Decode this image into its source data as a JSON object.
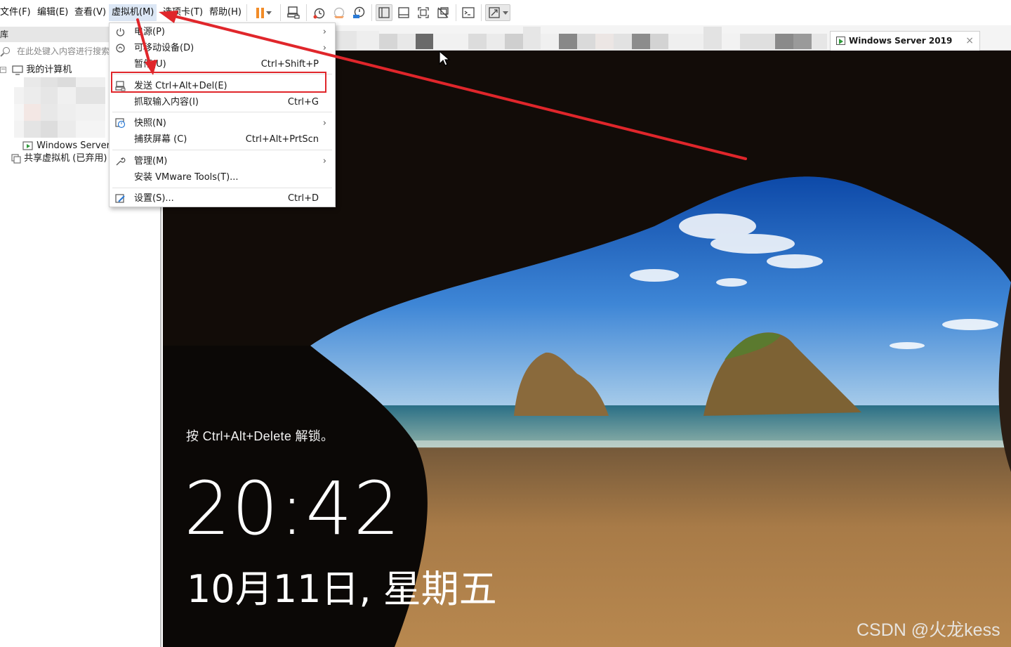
{
  "menubar": {
    "items": [
      {
        "label": "文件(F)"
      },
      {
        "label": "编辑(E)"
      },
      {
        "label": "查看(V)"
      },
      {
        "label": "虚拟机(M)"
      },
      {
        "label": "选项卡(T)"
      },
      {
        "label": "帮助(H)"
      }
    ]
  },
  "toolbar": {
    "buttons": [
      {
        "icon": "pause-icon"
      },
      {
        "icon": "send-ctrl-alt-del-icon"
      },
      {
        "icon": "snapshot-icon"
      },
      {
        "icon": "revert-snapshot-icon"
      },
      {
        "icon": "snapshot-manager-icon"
      },
      {
        "icon": "show-library-icon"
      },
      {
        "icon": "thumbnail-bar-icon"
      },
      {
        "icon": "full-screen-icon"
      },
      {
        "icon": "unity-icon"
      },
      {
        "icon": "console-view-icon"
      },
      {
        "icon": "stretch-guest-icon"
      }
    ]
  },
  "library": {
    "header": "库",
    "search_placeholder": "在此处键入内容进行搜索",
    "tree": [
      {
        "label": "我的计算机",
        "icon": "computer-icon"
      },
      {
        "label": "Windows Server",
        "icon": "vm-icon"
      },
      {
        "label": "共享虚拟机 (已弃用)",
        "icon": "shared-vm-icon"
      }
    ]
  },
  "tab": {
    "label": "Windows Server 2019",
    "close": "×"
  },
  "vm_menu": {
    "items": [
      {
        "label": "电源(P)",
        "shortcut": "",
        "submenu": true,
        "icon": "power-icon"
      },
      {
        "label": "可移动设备(D)",
        "shortcut": "",
        "submenu": true,
        "icon": "removable-device-icon"
      },
      {
        "label": "暂停(U)",
        "shortcut": "Ctrl+Shift+P",
        "submenu": false,
        "icon": ""
      },
      {
        "label": "发送 Ctrl+Alt+Del(E)",
        "shortcut": "",
        "submenu": false,
        "icon": "send-keys-icon"
      },
      {
        "label": "抓取输入内容(I)",
        "shortcut": "Ctrl+G",
        "submenu": false,
        "icon": ""
      },
      {
        "label": "快照(N)",
        "shortcut": "",
        "submenu": true,
        "icon": "snapshot-icon"
      },
      {
        "label": "捕获屏幕 (C)",
        "shortcut": "Ctrl+Alt+PrtScn",
        "submenu": false,
        "icon": ""
      },
      {
        "label": "管理(M)",
        "shortcut": "",
        "submenu": true,
        "icon": "wrench-icon"
      },
      {
        "label": "安装 VMware Tools(T)...",
        "shortcut": "",
        "submenu": false,
        "icon": ""
      },
      {
        "label": "设置(S)...",
        "shortcut": "Ctrl+D",
        "submenu": false,
        "icon": "settings-icon"
      }
    ],
    "arrow_glyph": "›"
  },
  "lockscreen": {
    "hint": "按 Ctrl+Alt+Delete 解锁。",
    "time": "20:42",
    "date": "10月11日, 星期五"
  },
  "watermark": "CSDN @火龙kess",
  "colors": {
    "annotation_red": "#e0262b",
    "menu_active": "#dce7f5",
    "pause_orange": "#f28c28"
  }
}
